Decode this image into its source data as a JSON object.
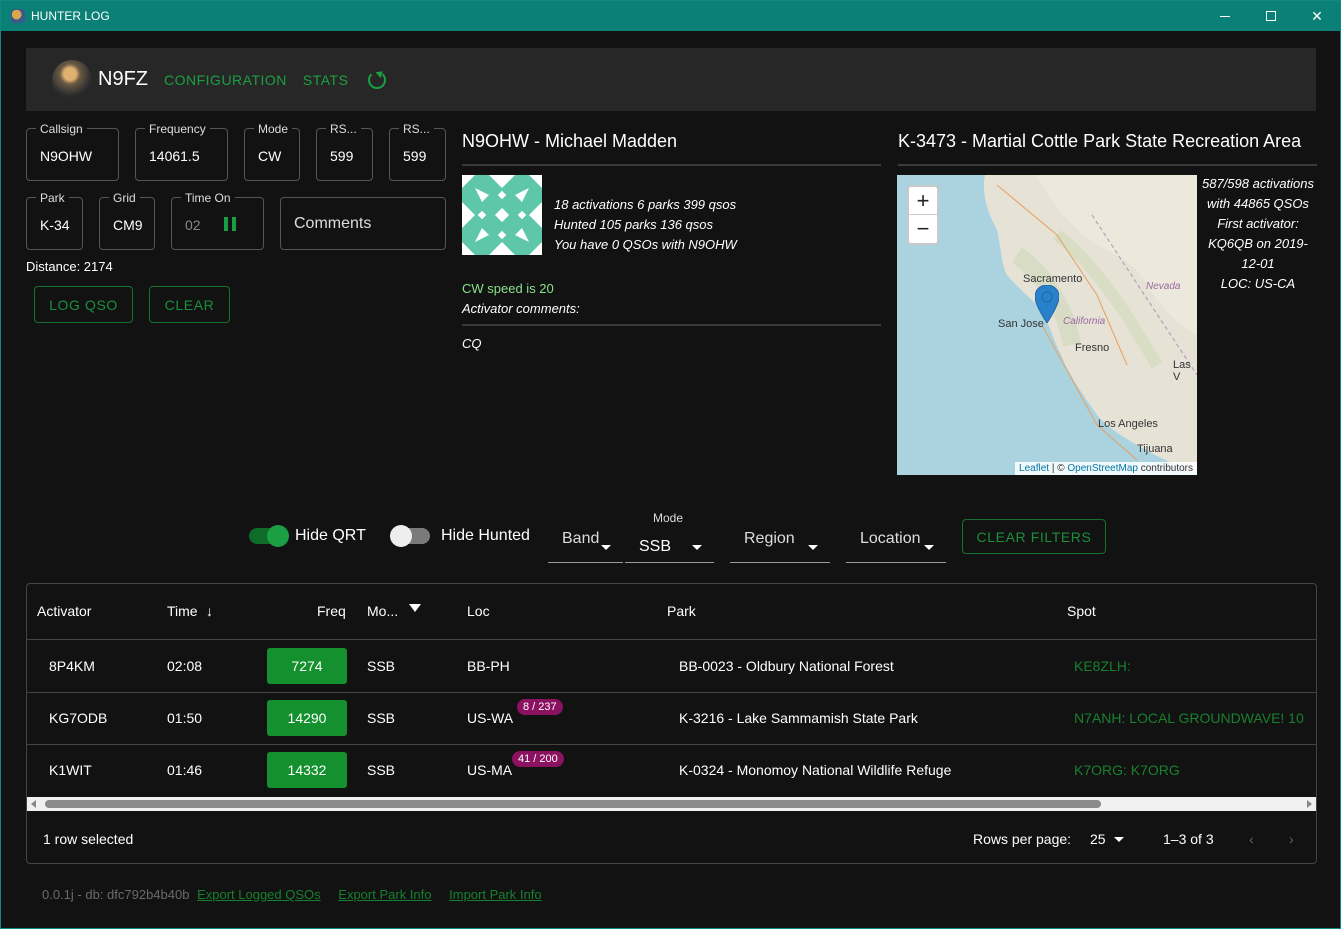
{
  "window": {
    "title": "HUNTER LOG"
  },
  "nav": {
    "callsign": "N9FZ",
    "configuration": "CONFIGURATION",
    "stats": "STATS"
  },
  "form": {
    "callsign": {
      "label": "Callsign",
      "value": "N9OHW"
    },
    "frequency": {
      "label": "Frequency",
      "value": "14061.5"
    },
    "mode": {
      "label": "Mode",
      "value": "CW"
    },
    "rst_sent": {
      "label": "RS...",
      "value": "599"
    },
    "rst_rcvd": {
      "label": "RS...",
      "value": "599"
    },
    "park": {
      "label": "Park",
      "value": "K-34"
    },
    "grid": {
      "label": "Grid",
      "value": "CM9"
    },
    "time_on": {
      "label": "Time On",
      "value": "02"
    },
    "comments": {
      "placeholder": "Comments"
    },
    "distance": "Distance: 2174",
    "log_qso": "LOG QSO",
    "clear": "CLEAR"
  },
  "activator": {
    "title": "N9OHW - Michael Madden",
    "stats": [
      "18 activations 6 parks 399 qsos",
      "Hunted 105 parks 136 qsos",
      "You have 0 QSOs with N9OHW"
    ],
    "cw_speed": "CW speed is 20",
    "comments_label": "Activator comments:",
    "comment": "CQ"
  },
  "park": {
    "title": "K-3473 - Martial Cottle Park State Recreation Area",
    "info": [
      "587/598 activations",
      "with 44865 QSOs",
      "First activator:",
      "KQ6QB on 2019-",
      "12-01",
      "LOC: US-CA"
    ],
    "map_labels": {
      "sacramento": "Sacramento",
      "nevada": "Nevada",
      "san_jose": "San Jose",
      "california": "California",
      "fresno": "Fresno",
      "las": "Las V",
      "los_angeles": "Los Angeles",
      "tijuana": "Tijuana"
    },
    "attribution": {
      "leaflet": "Leaflet",
      "sep": " | © ",
      "osm": "OpenStreetMap",
      "contrib": " contributors"
    },
    "zoom_in": "+",
    "zoom_out": "−"
  },
  "filters": {
    "hide_qrt": {
      "label": "Hide QRT",
      "on": true
    },
    "hide_hunted": {
      "label": "Hide Hunted",
      "on": false
    },
    "band": "Band",
    "mode_label": "Mode",
    "mode_value": "SSB",
    "region": "Region",
    "location": "Location",
    "clear_filters": "CLEAR FILTERS"
  },
  "table": {
    "headers": {
      "activator": "Activator",
      "time": "Time",
      "freq": "Freq",
      "mode": "Mo...",
      "loc": "Loc",
      "park": "Park",
      "spot": "Spot"
    },
    "rows": [
      {
        "activator": "8P4KM",
        "time": "02:08",
        "freq": "7274",
        "mode": "SSB",
        "loc": "BB-PH",
        "badge": "",
        "park": "BB-0023 - Oldbury National Forest",
        "spot": "KE8ZLH:"
      },
      {
        "activator": "KG7ODB",
        "time": "01:50",
        "freq": "14290",
        "mode": "SSB",
        "loc": "US-WA",
        "badge": "8 / 237",
        "park": "K-3216 - Lake Sammamish State Park",
        "spot": "N7ANH: LOCAL GROUNDWAVE! 10"
      },
      {
        "activator": "K1WIT",
        "time": "01:46",
        "freq": "14332",
        "mode": "SSB",
        "loc": "US-MA",
        "badge": "41 / 200",
        "park": "K-0324 - Monomoy National Wildlife Refuge",
        "spot": "K7ORG: K7ORG"
      }
    ],
    "selected": "1 row selected",
    "rows_per_page_label": "Rows per page:",
    "rows_per_page": "25",
    "range": "1–3 of 3"
  },
  "footer": {
    "version": "0.0.1j - db: dfc792b4b40b",
    "export_logged": "Export Logged QSOs",
    "export_park": "Export Park Info",
    "import_park": "Import Park Info"
  },
  "colors": {
    "accent": "#1aa042",
    "titlebar": "#0b8077",
    "badge": "#8b1260",
    "freq": "#14912e"
  }
}
